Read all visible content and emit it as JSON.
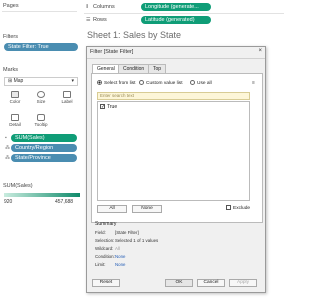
{
  "pages": {
    "title": "Pages"
  },
  "shelves": {
    "columns_label": "Columns",
    "rows_label": "Rows",
    "columns_pill": "Longitude (generate...",
    "rows_pill": "Latitude (generated)"
  },
  "filters": {
    "title": "Filters",
    "pill": "State Filter: True"
  },
  "marks": {
    "title": "Marks",
    "type": "Map",
    "buttons": [
      "Color",
      "Size",
      "Label",
      "Detail",
      "Tooltip"
    ],
    "fields": [
      "SUM(Sales)",
      "Country/Region",
      "State/Province"
    ]
  },
  "legend": {
    "title": "SUM(Sales)",
    "min": "920",
    "max": "457,688"
  },
  "sheet": {
    "title": "Sheet 1: Sales by State"
  },
  "dialog": {
    "title": "Filter [State Filter]",
    "close": "×",
    "tabs": [
      "General",
      "Condition",
      "Top"
    ],
    "options": {
      "select_from_list": "Select from list",
      "custom_value_list": "Custom value list",
      "use_all": "Use all"
    },
    "search_placeholder": "Enter search text",
    "items": [
      {
        "label": "True",
        "checked": true
      }
    ],
    "all_button": "All",
    "none_button": "None",
    "exclude_label": "Exclude",
    "summary": {
      "title": "Summary",
      "field_k": "Field:",
      "field_v": "[State Filter]",
      "selection_k": "Selection:",
      "selection_v": "Selected 1 of 1 values",
      "wildcard_k": "Wildcard:",
      "wildcard_v": "All",
      "condition_k": "Condition:",
      "condition_v": "None",
      "limit_k": "Limit:",
      "limit_v": "None"
    },
    "buttons": {
      "reset": "Reset",
      "ok": "OK",
      "cancel": "Cancel",
      "apply": "Apply"
    }
  },
  "colors": {
    "accent_green": "#0f9d77",
    "accent_blue": "#4a8db1",
    "link": "#1f5ab5"
  }
}
